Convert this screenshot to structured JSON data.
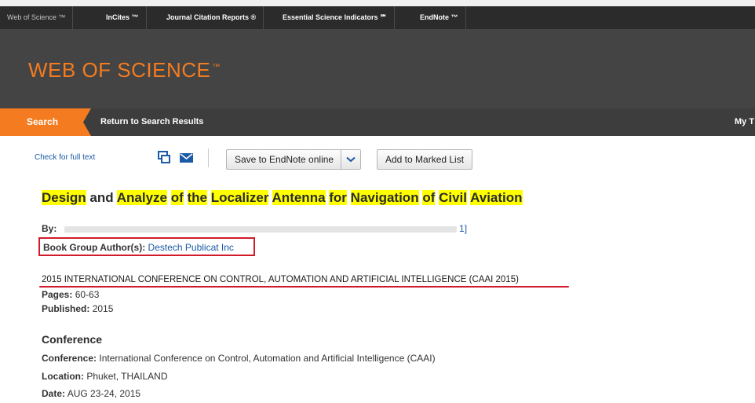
{
  "product_bar": {
    "items": [
      "Web of Science ™",
      "InCites ™",
      "Journal Citation Reports ®",
      "Essential Science Indicators ℠",
      "EndNote ™"
    ]
  },
  "brand": {
    "name": "WEB OF SCIENCE",
    "mark": "™"
  },
  "nav": {
    "search_label": "Search",
    "return_label": "Return to Search Results",
    "my_label": "My T"
  },
  "toolbar": {
    "check_full_text": "Check for full text",
    "save_label": "Save to EndNote online",
    "marked_label": "Add to Marked List"
  },
  "record": {
    "title_parts": [
      {
        "text": "Design",
        "hl": true
      },
      {
        "text": " and ",
        "hl": false
      },
      {
        "text": "Analyze",
        "hl": true
      },
      {
        "text": " ",
        "hl": false
      },
      {
        "text": "of",
        "hl": true
      },
      {
        "text": " ",
        "hl": false
      },
      {
        "text": "the",
        "hl": true
      },
      {
        "text": " ",
        "hl": false
      },
      {
        "text": "Localizer",
        "hl": true
      },
      {
        "text": " ",
        "hl": false
      },
      {
        "text": "Antenna",
        "hl": true
      },
      {
        "text": " ",
        "hl": false
      },
      {
        "text": "for",
        "hl": true
      },
      {
        "text": " ",
        "hl": false
      },
      {
        "text": "Navigation",
        "hl": true
      },
      {
        "text": " ",
        "hl": false
      },
      {
        "text": "of",
        "hl": true
      },
      {
        "text": " ",
        "hl": false
      },
      {
        "text": "Civil",
        "hl": true
      },
      {
        "text": " ",
        "hl": false
      },
      {
        "text": "Aviation",
        "hl": true
      }
    ],
    "by_label": "By:",
    "by_suffix": "1]",
    "book_group_label": "Book Group Author(s):",
    "book_group_value": "Destech Publicat Inc",
    "conference_source": "2015 INTERNATIONAL CONFERENCE ON CONTROL, AUTOMATION AND ARTIFICIAL INTELLIGENCE (CAAI 2015)",
    "pages_label": "Pages:",
    "pages_value": "60-63",
    "published_label": "Published:",
    "published_value": "2015",
    "conference_section": "Conference",
    "conference_label": "Conference:",
    "conference_value": "International Conference on Control, Automation and Artificial Intelligence (CAAI)",
    "location_label": "Location:",
    "location_value": "Phuket, THAILAND",
    "date_label": "Date:",
    "date_value": "AUG 23-24, 2015"
  },
  "colors": {
    "accent_orange": "#f47b20",
    "highlight": "#ffff00",
    "annotation_red": "#d11a2a",
    "link_blue": "#1a5aa6"
  }
}
